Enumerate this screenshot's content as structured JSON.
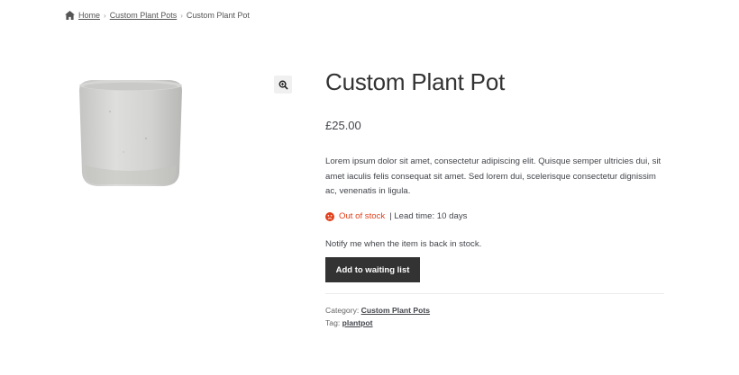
{
  "breadcrumb": {
    "home": "Home",
    "category": "Custom Plant Pots",
    "current": "Custom Plant Pot"
  },
  "icons": {
    "home": "home-icon",
    "zoom": "magnifier-zoom-icon",
    "stock": "sad-face-icon"
  },
  "product": {
    "title": "Custom Plant Pot",
    "price": "£25.00",
    "description": "Lorem ipsum dolor sit amet, consectetur adipiscing elit. Quisque semper ultricies dui, sit amet iaculis felis consequat sit amet. Sed lorem dui, scelerisque consectetur dignissim ac, venenatis in ligula.",
    "stock_status": "Out of stock",
    "lead_time": " | Lead time: 10 days",
    "notify_text": "Notify me when the item is back in stock.",
    "waitlist_button": "Add to waiting list",
    "category_label": "Category: ",
    "category_value": "Custom Plant Pots",
    "tag_label": "Tag: ",
    "tag_value": "plantpot"
  },
  "colors": {
    "out_of_stock": "#e2401c",
    "button_bg": "#333333",
    "text": "#43454b"
  }
}
